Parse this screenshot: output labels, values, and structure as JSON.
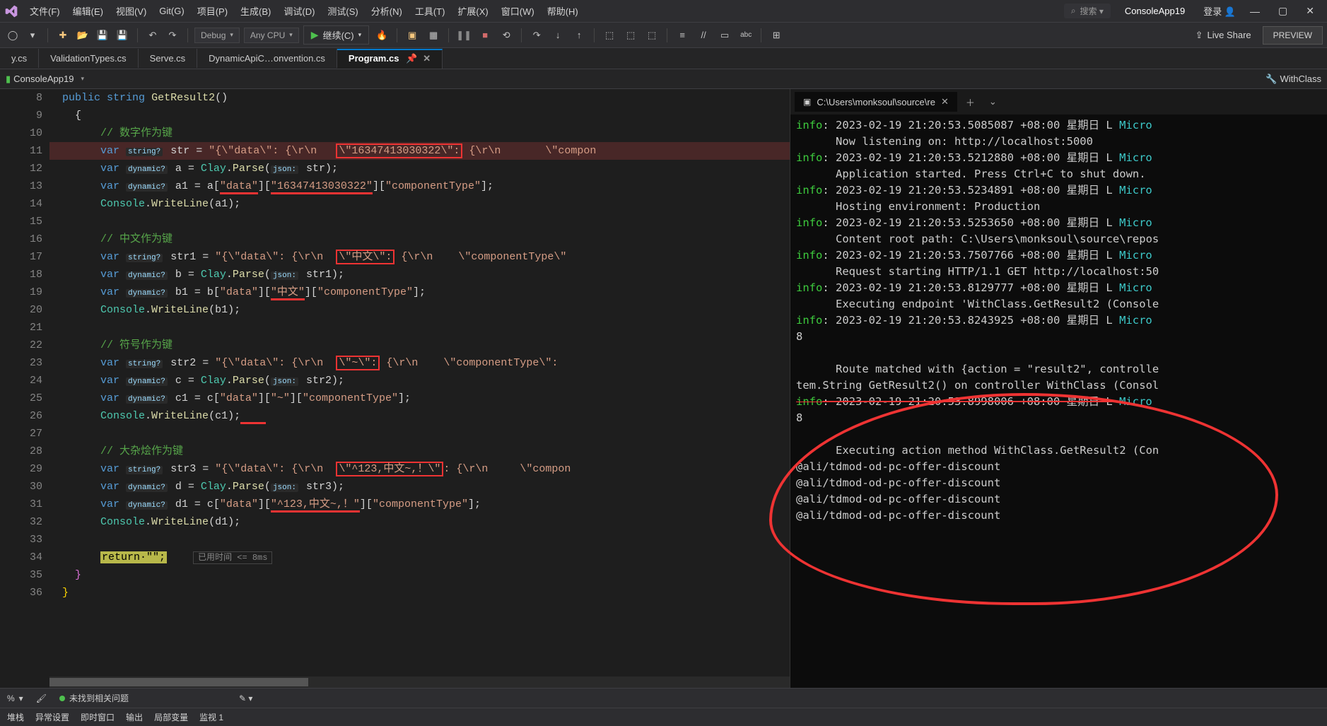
{
  "menu": {
    "items": [
      "文件(F)",
      "编辑(E)",
      "视图(V)",
      "Git(G)",
      "项目(P)",
      "生成(B)",
      "调试(D)",
      "测试(S)",
      "分析(N)",
      "工具(T)",
      "扩展(X)",
      "窗口(W)",
      "帮助(H)"
    ],
    "search_placeholder": "搜索 ▾",
    "project_title": "ConsoleApp19",
    "login": "登录"
  },
  "toolbar": {
    "config": "Debug",
    "platform": "Any CPU",
    "run_label": "继续(C)",
    "liveshare": "Live Share",
    "preview": "PREVIEW"
  },
  "tabs": [
    {
      "label": "y.cs",
      "active": false
    },
    {
      "label": "ValidationTypes.cs",
      "active": false
    },
    {
      "label": "Serve.cs",
      "active": false
    },
    {
      "label": "DynamicApiC…onvention.cs",
      "active": false
    },
    {
      "label": "Program.cs",
      "active": true
    }
  ],
  "breadcrumb": {
    "project": "ConsoleApp19",
    "symbol": "WithClass"
  },
  "editor": {
    "line_start": 8,
    "lines": [
      {
        "n": 8,
        "html": "<span class='kw'>public</span> <span class='kw'>string</span> <span class='method'>GetResult2</span>()"
      },
      {
        "n": 9,
        "html": "{"
      },
      {
        "n": 10,
        "html": "    <span class='comment'>// 数字作为键</span>"
      },
      {
        "n": 11,
        "html": "    <span class='kw'>var</span> <span class='tag-hint'>string?</span> str = <span class='str'>\"{\\\"data\\\": {\\r\\n   <span class='redbox'>\\\"16347413030322\\\":</span> {\\r\\n       \\\"compon</span>",
        "hl": true
      },
      {
        "n": 12,
        "html": "    <span class='kw'>var</span> <span class='tag-hint'>dynamic?</span> a = <span class='type'>Clay</span>.<span class='method'>Parse</span>(<span class='tag-hint'>json:</span> str);"
      },
      {
        "n": 13,
        "html": "    <span class='kw'>var</span> <span class='tag-hint'>dynamic?</span> a1 = a[<span class='str red-under'>\"data\"</span>][<span class='str red-under'>\"16347413030322\"</span>][<span class='str'>\"componentType\"</span>];"
      },
      {
        "n": 14,
        "html": "    <span class='type'>Console</span>.<span class='method'>WriteLine</span>(a1);"
      },
      {
        "n": 15,
        "html": ""
      },
      {
        "n": 16,
        "html": "    <span class='comment'>// 中文作为键</span>"
      },
      {
        "n": 17,
        "html": "    <span class='kw'>var</span> <span class='tag-hint'>string?</span> str1 = <span class='str'>\"{\\\"data\\\": {\\r\\n  <span class='redbox'>\\\"中文\\\":</span> {\\r\\n    \\\"componentType\\\"</span>"
      },
      {
        "n": 18,
        "html": "    <span class='kw'>var</span> <span class='tag-hint'>dynamic?</span> b = <span class='type'>Clay</span>.<span class='method'>Parse</span>(<span class='tag-hint'>json:</span> str1);"
      },
      {
        "n": 19,
        "html": "    <span class='kw'>var</span> <span class='tag-hint'>dynamic?</span> b1 = b[<span class='str'>\"data\"</span>][<span class='str red-under'>\"中文\"</span>][<span class='str'>\"componentType\"</span>];"
      },
      {
        "n": 20,
        "html": "    <span class='type'>Console</span>.<span class='method'>WriteLine</span>(b1);"
      },
      {
        "n": 21,
        "html": ""
      },
      {
        "n": 22,
        "html": "    <span class='comment'>// 符号作为键</span>"
      },
      {
        "n": 23,
        "html": "    <span class='kw'>var</span> <span class='tag-hint'>string?</span> str2 = <span class='str'>\"{\\\"data\\\": {\\r\\n  <span class='redbox'>\\\"~\\\":</span> {\\r\\n    \\\"componentType\\\": </span>"
      },
      {
        "n": 24,
        "html": "    <span class='kw'>var</span> <span class='tag-hint'>dynamic?</span> c = <span class='type'>Clay</span>.<span class='method'>Parse</span>(<span class='tag-hint'>json:</span> str2);"
      },
      {
        "n": 25,
        "html": "    <span class='kw'>var</span> <span class='tag-hint'>dynamic?</span> c1 = c[<span class='str'>\"data\"</span>][<span class='str'>\"~\"</span>][<span class='str'>\"componentType\"</span>];"
      },
      {
        "n": 26,
        "html": "    <span class='type'>Console</span>.<span class='method'>WriteLine</span>(c1);<span class='red-under'>    </span>"
      },
      {
        "n": 27,
        "html": ""
      },
      {
        "n": 28,
        "html": "    <span class='comment'>// 大杂烩作为键</span>"
      },
      {
        "n": 29,
        "html": "    <span class='kw'>var</span> <span class='tag-hint'>string?</span> str3 = <span class='str'>\"{\\\"data\\\": {\\r\\n  <span class='redbox'>\\\"^123,中文~,！\\\"</span>: {\\r\\n     \\\"compon</span>"
      },
      {
        "n": 30,
        "html": "    <span class='kw'>var</span> <span class='tag-hint'>dynamic?</span> d = <span class='type'>Clay</span>.<span class='method'>Parse</span>(<span class='tag-hint'>json:</span> str3);"
      },
      {
        "n": 31,
        "html": "    <span class='kw'>var</span> <span class='tag-hint'>dynamic?</span> d1 = c[<span class='str'>\"data\"</span>][<span class='str red-under'>\"^123,中文~,！\"</span>][<span class='str'>\"componentType\"</span>];"
      },
      {
        "n": 32,
        "html": "    <span class='type'>Console</span>.<span class='method'>WriteLine</span>(d1);"
      },
      {
        "n": 33,
        "html": ""
      },
      {
        "n": 34,
        "html": "    <span class='hl-return'>return·\"\";</span>   <span class='inline-time'>已用时间 &lt;= 8ms</span>"
      },
      {
        "n": 35,
        "html": "<span style='color:#da70d6'>}</span>"
      },
      {
        "n": 36,
        "html": "<span style='color:#ffd700'>}</span>"
      }
    ]
  },
  "terminal": {
    "tab_title": "C:\\Users\\monksoul\\source\\re",
    "lines": [
      {
        "t": "info",
        "text": ": 2023-02-19 21:20:53.5085087 +08:00 星期日 L ",
        "tail": "Micro"
      },
      {
        "t": "cont",
        "text": "Now listening on: http://localhost:5000"
      },
      {
        "t": "info",
        "text": ": 2023-02-19 21:20:53.5212880 +08:00 星期日 L ",
        "tail": "Micro"
      },
      {
        "t": "cont",
        "text": "Application started. Press Ctrl+C to shut down."
      },
      {
        "t": "info",
        "text": ": 2023-02-19 21:20:53.5234891 +08:00 星期日 L ",
        "tail": "Micro"
      },
      {
        "t": "cont",
        "text": "Hosting environment: Production"
      },
      {
        "t": "info",
        "text": ": 2023-02-19 21:20:53.5253650 +08:00 星期日 L ",
        "tail": "Micro"
      },
      {
        "t": "cont",
        "text": "Content root path: C:\\Users\\monksoul\\source\\repos"
      },
      {
        "t": "info",
        "text": ": 2023-02-19 21:20:53.7507766 +08:00 星期日 L ",
        "tail": "Micro"
      },
      {
        "t": "cont",
        "text": "Request starting HTTP/1.1 GET http://localhost:50"
      },
      {
        "t": "info",
        "text": ": 2023-02-19 21:20:53.8129777 +08:00 星期日 L ",
        "tail": "Micro"
      },
      {
        "t": "cont",
        "text": "Executing endpoint 'WithClass.GetResult2 (Console"
      },
      {
        "t": "info",
        "text": ": 2023-02-19 21:20:53.8243925 +08:00 星期日 L ",
        "tail": "Micro"
      },
      {
        "t": "plain",
        "text": "8"
      },
      {
        "t": "blank",
        "text": ""
      },
      {
        "t": "cont",
        "text": "Route matched with {action = \"result2\", controlle"
      },
      {
        "t": "plain",
        "text": "tem.String GetResult2() on controller WithClass (Consol"
      },
      {
        "t": "info-strike",
        "text": ": 2023-02-19 21:20:53.8998006 +08:00 星期日 L ",
        "tail": "Micro"
      },
      {
        "t": "plain",
        "text": "8"
      },
      {
        "t": "blank",
        "text": ""
      },
      {
        "t": "cont",
        "text": "Executing action method WithClass.GetResult2 (Con"
      },
      {
        "t": "plain",
        "text": "@ali/tdmod-od-pc-offer-discount"
      },
      {
        "t": "plain",
        "text": "@ali/tdmod-od-pc-offer-discount"
      },
      {
        "t": "plain",
        "text": "@ali/tdmod-od-pc-offer-discount"
      },
      {
        "t": "plain",
        "text": "@ali/tdmod-od-pc-offer-discount"
      }
    ]
  },
  "status": {
    "left_pct": "%",
    "problems": "未找到相关问题"
  },
  "bottom_tabs": [
    "堆栈",
    "异常设置",
    "即时窗口",
    "输出",
    "局部变量",
    "监视 1"
  ]
}
